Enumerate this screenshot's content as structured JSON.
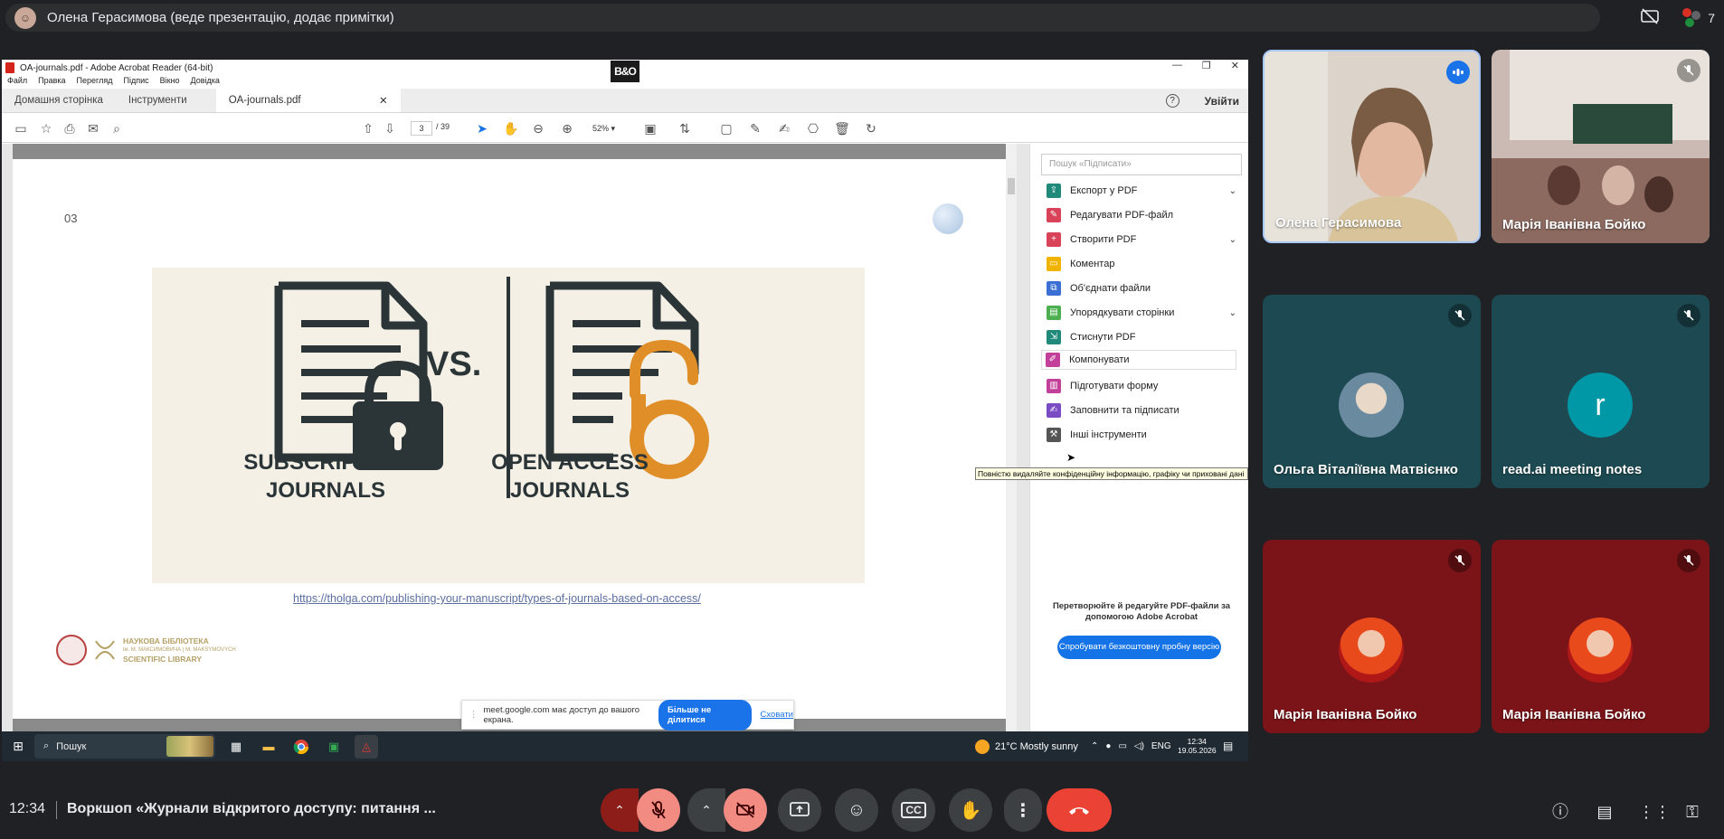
{
  "meet": {
    "presenter_banner": "Олена Герасимова (веде презентацію, додає примітки)",
    "participant_count": "7",
    "time": "12:34",
    "meeting_title": "Воркшоп «Журнали відкритого доступу: питання ..."
  },
  "acrobat": {
    "window_title": "OA-journals.pdf - Adobe Acrobat Reader (64-bit)",
    "bo_logo": "B&O",
    "menu": [
      "Файл",
      "Правка",
      "Перегляд",
      "Підпис",
      "Вікно",
      "Довідка"
    ],
    "tabs": {
      "home": "Домашня сторінка",
      "tools": "Інструменти",
      "file": "OA-journals.pdf"
    },
    "signin": "Увійти",
    "page_current": "3",
    "page_total": "/ 39",
    "zoom": "52%",
    "slide": {
      "number": "03",
      "left_title_1": "SUBSCRIPTION",
      "left_title_2": "JOURNALS",
      "vs": "VS.",
      "right_title_1": "OPEN ACCESS",
      "right_title_2": "JOURNALS",
      "link": "https://tholga.com/publishing-your-manuscript/types-of-journals-based-on-access/",
      "lib_line1": "НАУКОВА БІБЛІОТЕКА",
      "lib_line2": "ім. М. МАКСИМОВИЧА | М. MAKSYMOVYCH",
      "lib_line3": "SCIENTIFIC LIBRARY"
    },
    "tools_search_placeholder": "Пошук «Підписати»",
    "tools": [
      {
        "label": "Експорт у PDF",
        "color": "#1f8a7a"
      },
      {
        "label": "Редагувати PDF-файл",
        "color": "#d9435a"
      },
      {
        "label": "Створити PDF",
        "color": "#d9435a"
      },
      {
        "label": "Коментар",
        "color": "#f0b400"
      },
      {
        "label": "Об'єднати файли",
        "color": "#3b6fd4"
      },
      {
        "label": "Упорядкувати сторінки",
        "color": "#4caf50"
      },
      {
        "label": "Стиснути PDF",
        "color": "#1f8a7a"
      },
      {
        "label": "Компонувати",
        "color": "#c2409a"
      },
      {
        "label": "Підготувати форму",
        "color": "#c2409a"
      },
      {
        "label": "Заповнити та підписати",
        "color": "#7b4dc4"
      },
      {
        "label": "Інші інструменти",
        "color": "#555555"
      }
    ],
    "tooltip": "Повністю видаляйте конфіденційну інформацію, графіку чи приховані дані",
    "promo_text": "Перетворюйте й редагуйте PDF-файли за допомогою Adobe Acrobat",
    "promo_button": "Спробувати безкоштовну пробну версію"
  },
  "share_banner": {
    "text": "meet.google.com має доступ до вашого екрана.",
    "stop": "Більше не ділитися",
    "hide": "Сховати"
  },
  "windows": {
    "search": "Пошук",
    "weather": "21°C  Mostly sunny",
    "lang": "ENG",
    "clock_time": "12:34",
    "clock_date": "19.05.2026"
  },
  "participants": [
    {
      "name": "Олена Герасимова"
    },
    {
      "name": "Марія Іванівна Бойко"
    },
    {
      "name": "Ольга Віталіївна Матвієнко"
    },
    {
      "name": "read.ai meeting notes",
      "initial": "r"
    },
    {
      "name": "Марія Іванівна Бойко"
    },
    {
      "name": "Марія Іванівна Бойко"
    }
  ]
}
